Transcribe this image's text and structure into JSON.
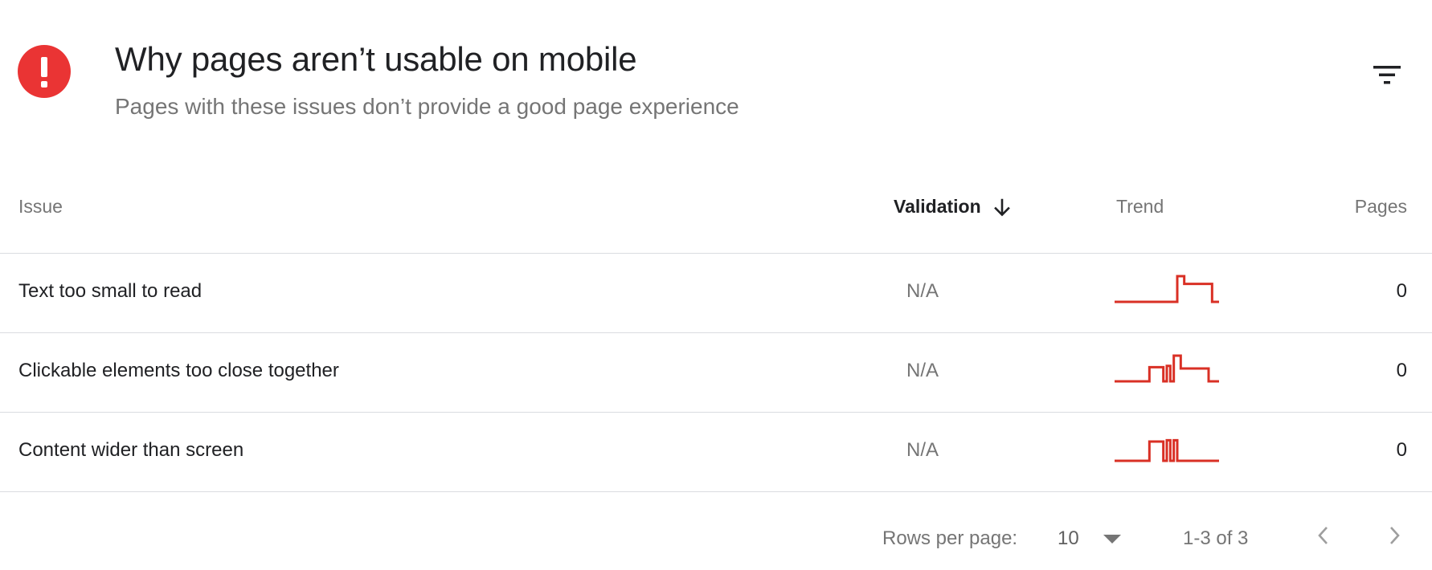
{
  "header": {
    "title": "Why pages aren’t usable on mobile",
    "subtitle": "Pages with these issues don’t provide a good page experience",
    "status_icon": "error-exclamation-icon",
    "status_color": "#ea3434",
    "filter_icon": "filter-icon"
  },
  "table": {
    "columns": {
      "issue": "Issue",
      "validation": "Validation",
      "trend": "Trend",
      "pages": "Pages"
    },
    "sort": {
      "column": "Validation",
      "direction": "descending",
      "icon": "arrow-down-icon"
    },
    "trend_color": "#d93025",
    "rows": [
      {
        "issue": "Text too small to read",
        "validation": "N/A",
        "pages": "0",
        "trend": [
          0,
          0,
          0,
          0,
          0,
          0,
          0,
          0,
          0,
          0,
          0,
          0,
          0,
          0,
          0,
          0,
          0,
          0,
          1,
          1,
          0.7,
          0.7,
          0.7,
          0.7,
          0.7,
          0.7,
          0.7,
          0.7,
          0,
          0
        ]
      },
      {
        "issue": "Clickable elements too close together",
        "validation": "N/A",
        "pages": "0",
        "trend": [
          0,
          0,
          0,
          0,
          0,
          0,
          0,
          0,
          0,
          0,
          0.55,
          0.55,
          0.55,
          0.55,
          0,
          0.6,
          0,
          1,
          1,
          0.5,
          0.5,
          0.5,
          0.5,
          0.5,
          0.5,
          0.5,
          0.5,
          0,
          0,
          0
        ]
      },
      {
        "issue": "Content wider than screen",
        "validation": "N/A",
        "pages": "0",
        "trend": [
          0,
          0,
          0,
          0,
          0,
          0,
          0,
          0,
          0,
          0,
          0.75,
          0.75,
          0.75,
          0.75,
          0,
          0.8,
          0,
          0.8,
          0,
          0,
          0,
          0,
          0,
          0,
          0,
          0,
          0,
          0,
          0,
          0
        ]
      }
    ]
  },
  "footer": {
    "rows_per_page_label": "Rows per page:",
    "rows_per_page_value": "10",
    "range": "1-3 of 3",
    "prev_icon": "chevron-left-icon",
    "next_icon": "chevron-right-icon",
    "caret_icon": "dropdown-caret-icon"
  }
}
